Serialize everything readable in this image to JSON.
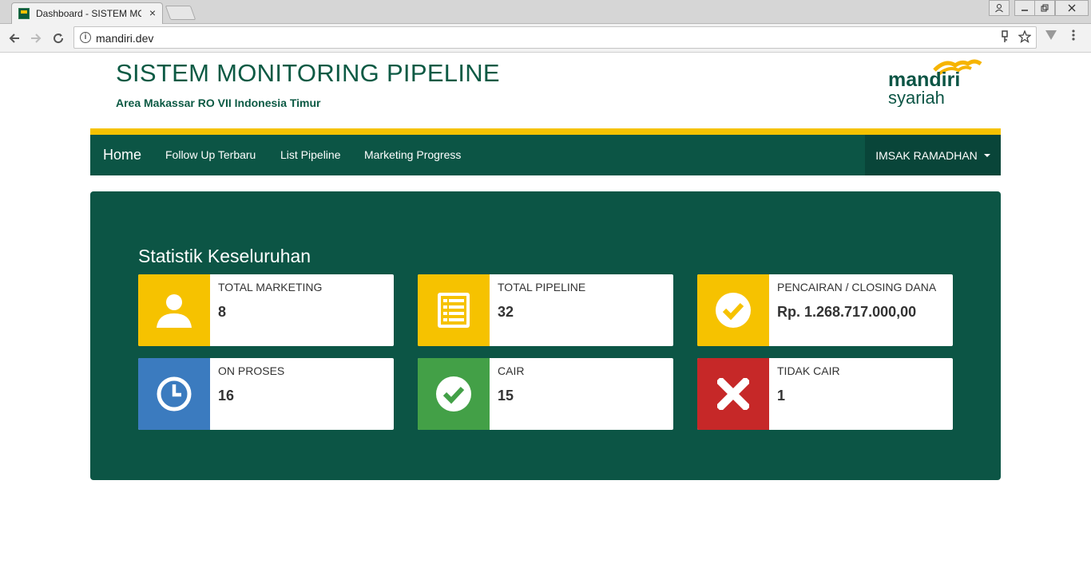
{
  "browser": {
    "tab_title": "Dashboard - SISTEM MO",
    "tab_close": "×",
    "url": "mandiri.dev"
  },
  "header": {
    "title": "SISTEM MONITORING PIPELINE",
    "subtitle": "Area Makassar RO VII Indonesia Timur",
    "logo_text": "mandiri",
    "logo_subtext": "syariah"
  },
  "nav": {
    "brand": "Home",
    "links": [
      "Follow Up Terbaru",
      "List Pipeline",
      "Marketing Progress"
    ],
    "user": "IMSAK RAMADHAN"
  },
  "panel": {
    "heading": "Statistik Keseluruhan"
  },
  "cards": [
    {
      "label": "TOTAL MARKETING",
      "value": "8",
      "icon": "user-icon",
      "color": "#f6c200"
    },
    {
      "label": "TOTAL PIPELINE",
      "value": "32",
      "icon": "list-icon",
      "color": "#f6c200"
    },
    {
      "label": "PENCAIRAN / CLOSING DANA",
      "value": "Rp. 1.268.717.000,00",
      "icon": "check-circle-icon",
      "color": "#f6c200"
    },
    {
      "label": "ON PROSES",
      "value": "16",
      "icon": "clock-icon",
      "color": "#3b7bbf"
    },
    {
      "label": "CAIR",
      "value": "15",
      "icon": "check-circle-icon",
      "color": "#43a047"
    },
    {
      "label": "TIDAK CAIR",
      "value": "1",
      "icon": "times-icon",
      "color": "#c62828"
    }
  ],
  "colors": {
    "primary": "#0c5545",
    "accent": "#f6c200",
    "blue": "#3b7bbf",
    "green": "#43a047",
    "red": "#c62828"
  }
}
